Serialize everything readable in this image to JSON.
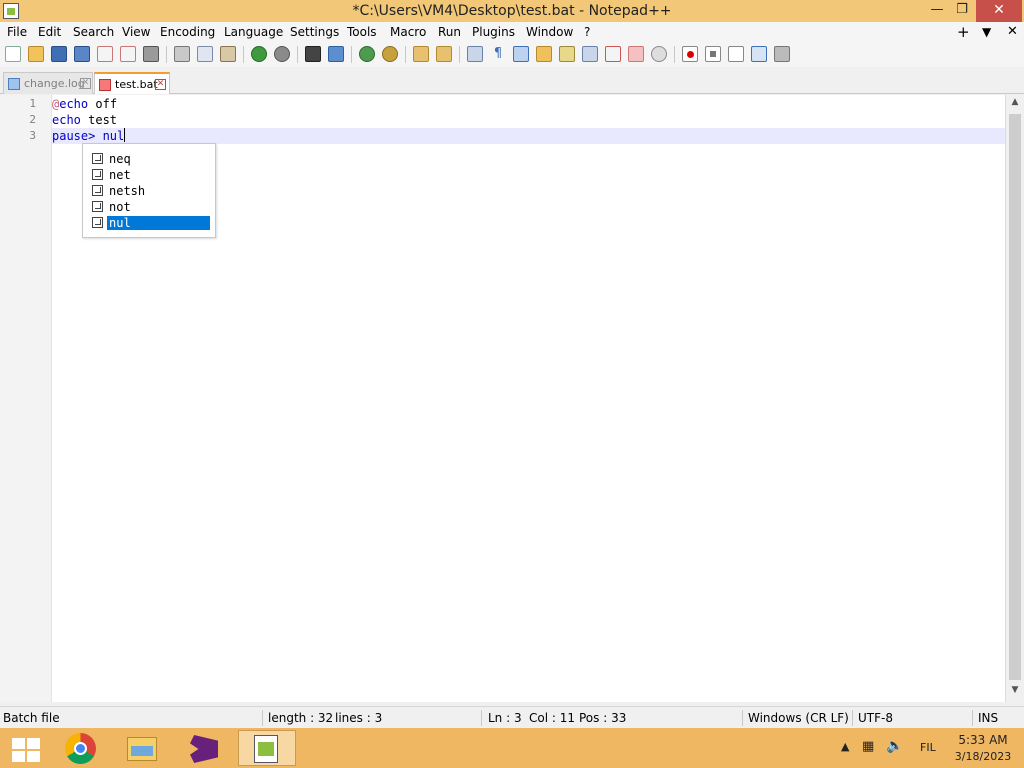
{
  "window": {
    "title": "*C:\\Users\\VM4\\Desktop\\test.bat - Notepad++",
    "minimize": "—",
    "restore": "❐",
    "close": "✕"
  },
  "menu": {
    "items": [
      "File",
      "Edit",
      "Search",
      "View",
      "Encoding",
      "Language",
      "Settings",
      "Tools",
      "Macro",
      "Run",
      "Plugins",
      "Window",
      "?"
    ],
    "right_plus": "+",
    "right_down": "▼",
    "right_close": "✕"
  },
  "tabs": [
    {
      "label": "change.log",
      "active": false
    },
    {
      "label": "test.bat",
      "active": true
    }
  ],
  "editor": {
    "line_numbers": [
      "1",
      "2",
      "3"
    ],
    "line1": {
      "at": "@",
      "kw": "echo",
      "rest": " off"
    },
    "line2": {
      "kw": "echo",
      "rest": " test"
    },
    "line3": {
      "kw": "pause",
      "op": ">",
      "rest": " nul"
    }
  },
  "autocomplete": {
    "items": [
      "neq",
      "net",
      "netsh",
      "not",
      "nul"
    ],
    "selected": "nul"
  },
  "status": {
    "language": "Batch file",
    "length": "length : 32",
    "lines": "lines : 3",
    "ln": "Ln : 3",
    "col": "Col : 11",
    "pos": "Pos : 33",
    "eol": "Windows (CR LF)",
    "encoding": "UTF-8",
    "mode": "INS"
  },
  "taskbar": {
    "lang": "FIL",
    "time": "5:33 AM",
    "date": "3/18/2023"
  },
  "colors": {
    "titlebar": "#f2c777",
    "taskbar": "#f0b763",
    "keyword": "#0000c8",
    "selection": "#0078d7"
  }
}
